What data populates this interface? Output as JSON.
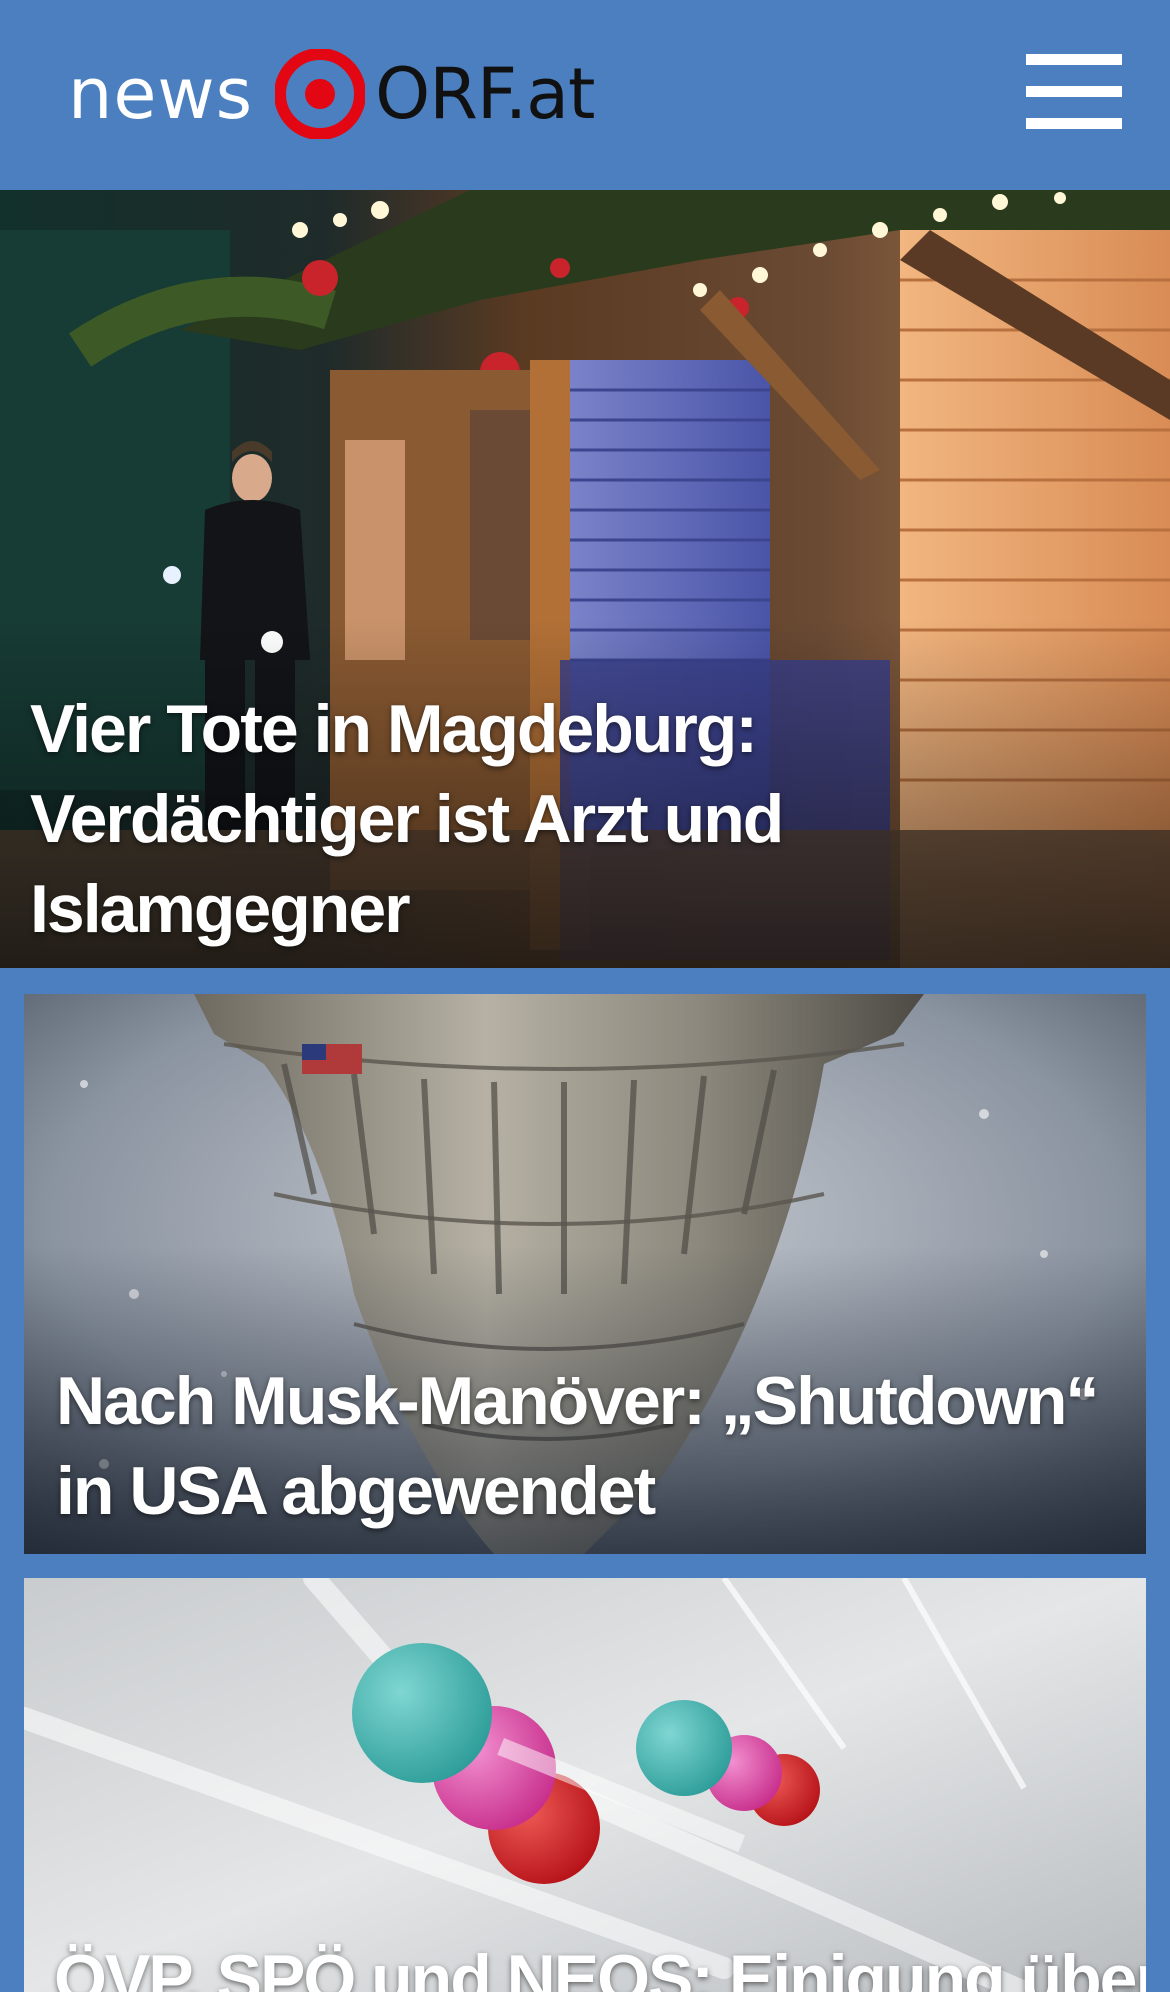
{
  "header": {
    "logo_news": "news",
    "logo_orf": "ORF.at",
    "menu_icon": "hamburger-menu-icon",
    "background_color": "#4b7fbf",
    "brand_red": "#e30613"
  },
  "stories": [
    {
      "title": "Vier Tote in Magdeburg: Verdächtiger ist Arzt und Islamgegner",
      "image": "christmas-market-police-photo"
    },
    {
      "title": "Nach Musk-Manöver: „Shutdown“ in USA abgewendet",
      "image": "capitol-dome-reflection-photo"
    },
    {
      "title": "ÖVP, SPÖ und NEOS: Einigung über",
      "image": "molecule-model-photo"
    }
  ]
}
